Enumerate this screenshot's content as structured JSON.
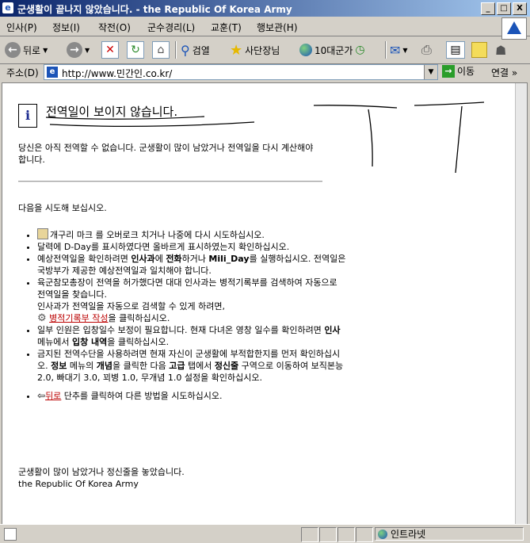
{
  "window": {
    "title": "군생활이 끝나지 않았습니다. - the Republic Of Korea Army",
    "minimize": "_",
    "maximize": "□",
    "close": "X"
  },
  "menu": [
    "인사(P)",
    "정보(I)",
    "작전(O)",
    "군수경리(L)",
    "교훈(T)",
    "행보관(H)"
  ],
  "toolbar": {
    "back": "뒤로",
    "search": "검열",
    "favorites": "사단장님",
    "media": "10대군가"
  },
  "address": {
    "label": "주소(D)",
    "url": "http://www.민간인.co.kr/",
    "go": "이동",
    "links": "연결"
  },
  "page": {
    "heading": "전역일이 보이지 않습니다.",
    "intro": "당신은 아직 전역할 수 없습니다. 군생활이 많이 남았거나 전역일을 다시 계산해야 합니다.",
    "try_label": "다음을 시도해 보십시오.",
    "items": {
      "i1": "개구리 마크 를 오버로크 치거나 나중에 다시 시도하십시오.",
      "i2": "달력에 D-Day를 표시하였다면 올바르게 표시하였는지 확인하십시오.",
      "i3a": "예상전역일을 확인하려면 ",
      "i3b": "인사과",
      "i3c": "에 ",
      "i3d": "전화",
      "i3e": "하거나 ",
      "i3f": "Mili_Day",
      "i3g": "를 실행하십시오. 전역일은 국방부가 제공한 예상전역일과 일치해야 합니다.",
      "i4a": "육군참모총장이 전역을 허가했다면 대대 인사과는 병적기록부를 검색하여 자동으로 전역일을 찾습니다.",
      "i4b": "인사과가 전역일을 자동으로 검색할 수 있게 하려면,",
      "i4link": "병적기록부 작성",
      "i4c": "을 클릭하십시오.",
      "i5a": "일부 인원은 입창일수 보정이 필요합니다. 현재 다녀온 영창 일수를 확인하려면 ",
      "i5b": "인사",
      "i5c": " 메뉴에서 ",
      "i5d": "입창 내역",
      "i5e": "을 클릭하십시오.",
      "i6a": "금지된 전역수단을 사용하려면 현재 자신이 군생활에 부적합한지를 먼저 확인하십시오. ",
      "i6b": "정보",
      "i6c": " 메뉴의 ",
      "i6d": "개념",
      "i6e": "을 클릭한 다음 ",
      "i6f": "고급",
      "i6g": " 탭에서 ",
      "i6h": "정신줄",
      "i6i": " 구역으로 이동하여 보직본능 2.0, 빠대기 3.0, 꾀병 1.0, 무개념 1.0 설정을 확인하십시오.",
      "i7link": "뒤로",
      "i7b": " 단추를 클릭하여 다른 방법을 시도하십시오."
    },
    "footer1": "군생활이 많이 남았거나 정신줄을 놓았습니다.",
    "footer2": "the Republic Of Korea Army"
  },
  "status": {
    "zone": "인트라넷"
  }
}
